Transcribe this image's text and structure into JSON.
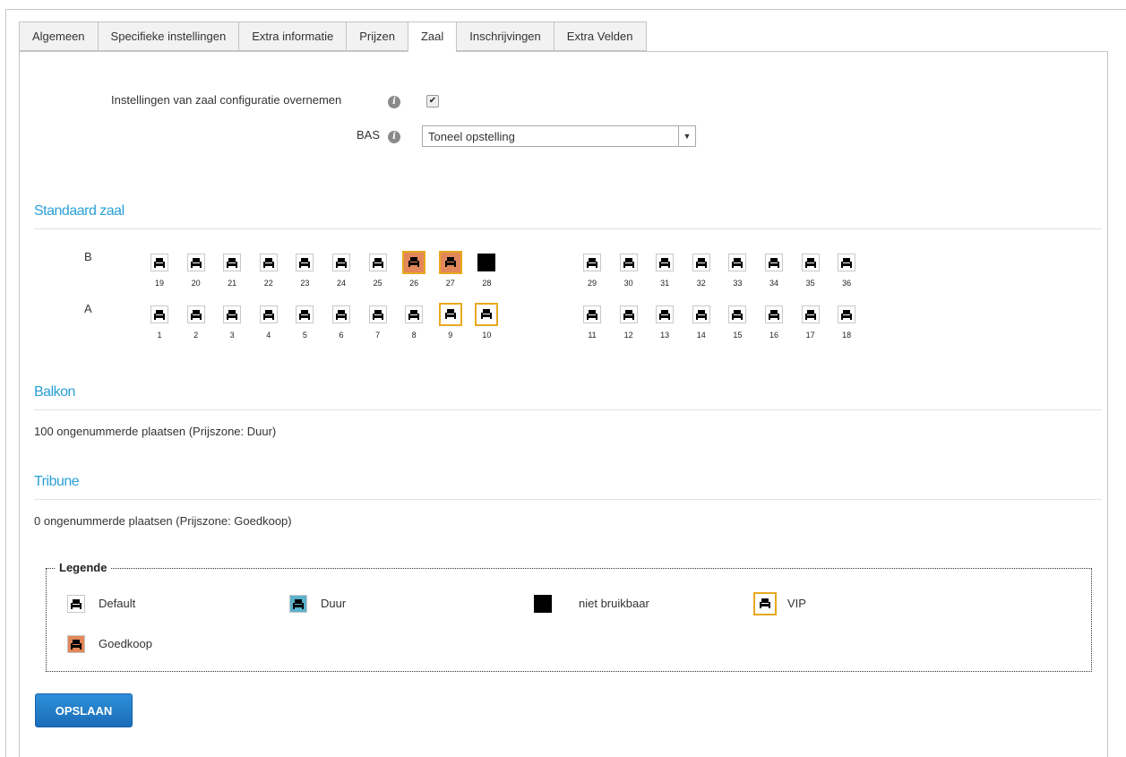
{
  "tabs": [
    {
      "label": "Algemeen"
    },
    {
      "label": "Specifieke instellingen"
    },
    {
      "label": "Extra informatie"
    },
    {
      "label": "Prijzen"
    },
    {
      "label": "Zaal"
    },
    {
      "label": "Inschrijvingen"
    },
    {
      "label": "Extra Velden"
    }
  ],
  "active_tab": "Zaal",
  "settings": {
    "copy_config_label": "Instellingen van zaal configuratie overnemen",
    "copy_config_checked": true,
    "bas_label": "BAS",
    "bas_value": "Toneel opstelling"
  },
  "sections": {
    "standaard": "Standaard zaal",
    "balkon": "Balkon",
    "balkon_text": "100 ongenummerde plaatsen (Prijszone: Duur)",
    "tribune": "Tribune",
    "tribune_text": "0 ongenummerde plaatsen (Prijszone: Goedkoop)"
  },
  "seat_rows": [
    {
      "label": "B",
      "seats": [
        {
          "num": "19",
          "zone": "default"
        },
        {
          "num": "20",
          "zone": "default"
        },
        {
          "num": "21",
          "zone": "default"
        },
        {
          "num": "22",
          "zone": "default"
        },
        {
          "num": "23",
          "zone": "default"
        },
        {
          "num": "24",
          "zone": "default"
        },
        {
          "num": "25",
          "zone": "default"
        },
        {
          "num": "26",
          "zone": "goedkoop",
          "vip": true
        },
        {
          "num": "27",
          "zone": "goedkoop",
          "vip": true
        },
        {
          "num": "28",
          "zone": "niet-bruikbaar"
        },
        {
          "num": "29",
          "zone": "default"
        },
        {
          "num": "30",
          "zone": "default"
        },
        {
          "num": "31",
          "zone": "default"
        },
        {
          "num": "32",
          "zone": "default"
        },
        {
          "num": "33",
          "zone": "default"
        },
        {
          "num": "34",
          "zone": "default"
        },
        {
          "num": "35",
          "zone": "default"
        },
        {
          "num": "36",
          "zone": "default"
        }
      ]
    },
    {
      "label": "A",
      "seats": [
        {
          "num": "1",
          "zone": "default"
        },
        {
          "num": "2",
          "zone": "default"
        },
        {
          "num": "3",
          "zone": "default"
        },
        {
          "num": "4",
          "zone": "default"
        },
        {
          "num": "5",
          "zone": "default"
        },
        {
          "num": "6",
          "zone": "default"
        },
        {
          "num": "7",
          "zone": "default"
        },
        {
          "num": "8",
          "zone": "default"
        },
        {
          "num": "9",
          "zone": "default",
          "vip": true
        },
        {
          "num": "10",
          "zone": "default",
          "vip": true
        },
        {
          "num": "11",
          "zone": "default"
        },
        {
          "num": "12",
          "zone": "default"
        },
        {
          "num": "13",
          "zone": "default"
        },
        {
          "num": "14",
          "zone": "default"
        },
        {
          "num": "15",
          "zone": "default"
        },
        {
          "num": "16",
          "zone": "default"
        },
        {
          "num": "17",
          "zone": "default"
        },
        {
          "num": "18",
          "zone": "default"
        }
      ]
    }
  ],
  "legend": {
    "title": "Legende",
    "items": {
      "default": "Default",
      "duur": "Duur",
      "nb": "niet bruikbaar",
      "vip": "VIP",
      "goedkoop": "Goedkoop"
    }
  },
  "colors": {
    "goedkoop": "#e2875a",
    "duur": "#5ab1cc",
    "vip_border": "#e9a81f",
    "section_title": "#2aa0d6",
    "button": "#1f7ac6"
  },
  "save_button": "OPSLAAN"
}
